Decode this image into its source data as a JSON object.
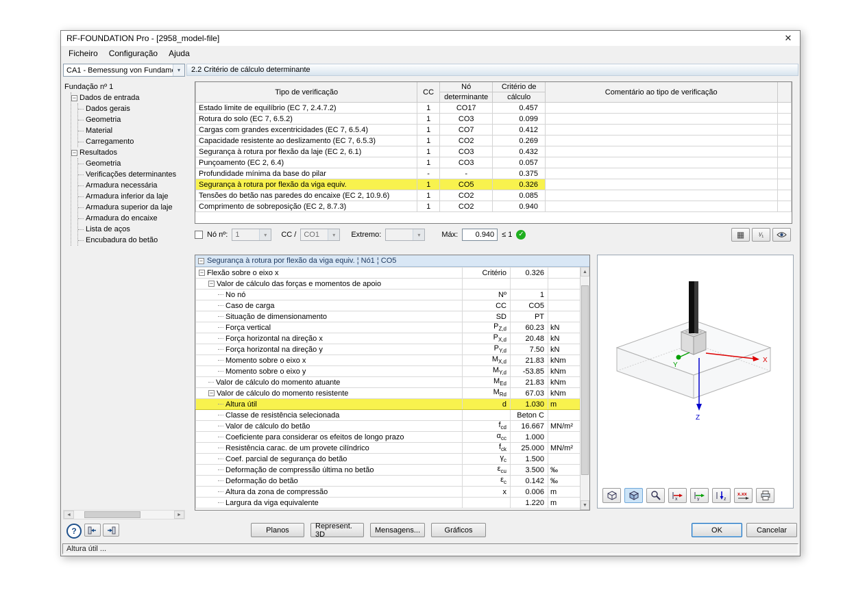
{
  "window": {
    "title": "RF-FOUNDATION Pro - [2958_model-file]"
  },
  "icons": {
    "close": "✕",
    "check": "✓",
    "combo_arrow": "▾",
    "minus": "−",
    "help": "?",
    "scroll_left": "◄",
    "scroll_right": "►",
    "scroll_up": "▲",
    "scroll_down": "▼",
    "grid": "▦",
    "ratio": "¹⁄₁",
    "values_label": "x.xx",
    "axis_x_label": "x",
    "axis_y_label": "y",
    "axis_z_label": "z"
  },
  "colors": {
    "highlight": "#f8f24e",
    "header_blue": "#d9e7f5",
    "green_check": "#1faf1f",
    "pressed_blue": "#cce4f7"
  },
  "menu": [
    "Ficheiro",
    "Configuração",
    "Ajuda"
  ],
  "sidebar": {
    "case_selector": "CA1 - Bemessung von Fundame",
    "tree": {
      "root": "Fundação nº 1",
      "groups": [
        {
          "label": "Dados de entrada",
          "children": [
            "Dados gerais",
            "Geometria",
            "Material",
            "Carregamento"
          ]
        },
        {
          "label": "Resultados",
          "children": [
            "Geometria",
            "Verificações determinantes",
            "Armadura necessária",
            "Armadura inferior da laje",
            "Armadura superior da laje",
            "Armadura do encaixe",
            "Lista de aços",
            "Encubadura do betão"
          ]
        }
      ]
    }
  },
  "section_title": "2.2 Critério de cálculo determinante",
  "summary_table": {
    "headers": {
      "type": "Tipo de verificação",
      "cc": "CC",
      "node1": "Nó",
      "node2": "determinante",
      "crit1": "Critério de",
      "crit2": "cálculo",
      "comment": "Comentário ao tipo de verificação"
    },
    "rows": [
      {
        "type": "Estado limite de equilíbrio (EC 7, 2.4.7.2)",
        "cc": "1",
        "node": "CO17",
        "crit": "0.457",
        "comment": "",
        "highlight": false
      },
      {
        "type": "Rotura do solo (EC 7, 6.5.2)",
        "cc": "1",
        "node": "CO3",
        "crit": "0.099",
        "comment": "",
        "highlight": false
      },
      {
        "type": "Cargas com grandes excentricidades (EC 7, 6.5.4)",
        "cc": "1",
        "node": "CO7",
        "crit": "0.412",
        "comment": "",
        "highlight": false
      },
      {
        "type": "Capacidade resistente ao deslizamento (EC 7, 6.5.3)",
        "cc": "1",
        "node": "CO2",
        "crit": "0.269",
        "comment": "",
        "highlight": false
      },
      {
        "type": "Segurança à rotura por flexão da laje (EC 2, 6.1)",
        "cc": "1",
        "node": "CO3",
        "crit": "0.432",
        "comment": "",
        "highlight": false
      },
      {
        "type": "Punçoamento (EC 2, 6.4)",
        "cc": "1",
        "node": "CO3",
        "crit": "0.057",
        "comment": "",
        "highlight": false
      },
      {
        "type": "Profundidade mínima da base do pilar",
        "cc": "-",
        "node": "-",
        "crit": "0.375",
        "comment": "",
        "highlight": false
      },
      {
        "type": "Segurança à rotura por flexão da viga equiv.",
        "cc": "1",
        "node": "CO5",
        "crit": "0.326",
        "comment": "",
        "highlight": true
      },
      {
        "type": "Tensões do betão nas paredes do encaixe (EC 2, 10.9.6)",
        "cc": "1",
        "node": "CO2",
        "crit": "0.085",
        "comment": "",
        "highlight": false
      },
      {
        "type": "Comprimento de sobreposição (EC 2, 8.7.3)",
        "cc": "1",
        "node": "CO2",
        "crit": "0.940",
        "comment": "",
        "highlight": false
      }
    ]
  },
  "filter": {
    "node_label": "Nó nº:",
    "node_value": "1",
    "cc_label": "CC /",
    "cc_value": "CO1",
    "extremo_label": "Extremo:",
    "extremo_value": "",
    "max_label": "Máx:",
    "max_value": "0.940",
    "max_limit": "≤ 1"
  },
  "detail_panel": {
    "title": "Segurança à rotura por flexão da viga equiv. ¦ Nó1 ¦ CO5",
    "rows": [
      {
        "level": 0,
        "exp": true,
        "label": "Flexão sobre o eixo x",
        "sym": {
          "m": "Critério",
          "s": ""
        },
        "value": "0.326",
        "unit": "",
        "hl": false
      },
      {
        "level": 1,
        "exp": true,
        "label": "Valor de cálculo das forças e momentos de apoio",
        "sym": null,
        "value": "",
        "unit": "",
        "hl": false
      },
      {
        "level": 2,
        "exp": false,
        "label": "No nó",
        "sym": {
          "m": "Nº",
          "s": ""
        },
        "value": "1",
        "unit": "",
        "hl": false
      },
      {
        "level": 2,
        "exp": false,
        "label": "Caso de carga",
        "sym": {
          "m": "CC",
          "s": ""
        },
        "value": "CO5",
        "unit": "",
        "hl": false
      },
      {
        "level": 2,
        "exp": false,
        "label": "Situação de dimensionamento",
        "sym": {
          "m": "SD",
          "s": ""
        },
        "value": "PT",
        "unit": "",
        "hl": false
      },
      {
        "level": 2,
        "exp": false,
        "label": "Força vertical",
        "sym": {
          "m": "P",
          "s": "Z,d"
        },
        "value": "60.23",
        "unit": "kN",
        "hl": false
      },
      {
        "level": 2,
        "exp": false,
        "label": "Força horizontal na direção x",
        "sym": {
          "m": "P",
          "s": "X,d"
        },
        "value": "20.48",
        "unit": "kN",
        "hl": false
      },
      {
        "level": 2,
        "exp": false,
        "label": "Força horizontal na direção y",
        "sym": {
          "m": "P",
          "s": "Y,d"
        },
        "value": "7.50",
        "unit": "kN",
        "hl": false
      },
      {
        "level": 2,
        "exp": false,
        "label": "Momento sobre o eixo x",
        "sym": {
          "m": "M",
          "s": "X,d"
        },
        "value": "21.83",
        "unit": "kNm",
        "hl": false
      },
      {
        "level": 2,
        "exp": false,
        "label": "Momento sobre o eixo y",
        "sym": {
          "m": "M",
          "s": "Y,d"
        },
        "value": "-53.85",
        "unit": "kNm",
        "hl": false
      },
      {
        "level": 1,
        "exp": false,
        "label": "Valor de cálculo do momento atuante",
        "sym": {
          "m": "M",
          "s": "Ed"
        },
        "value": "21.83",
        "unit": "kNm",
        "hl": false
      },
      {
        "level": 1,
        "exp": true,
        "label": "Valor de cálculo do momento resistente",
        "sym": {
          "m": "M",
          "s": "Rd"
        },
        "value": "67.03",
        "unit": "kNm",
        "hl": false
      },
      {
        "level": 2,
        "exp": false,
        "label": "Altura útil",
        "sym": {
          "m": "d",
          "s": ""
        },
        "value": "1.030",
        "unit": "m",
        "hl": true
      },
      {
        "level": 2,
        "exp": false,
        "label": "Classe de resistência selecionada",
        "sym": null,
        "value": "Beton C",
        "unit": "",
        "hl": false
      },
      {
        "level": 2,
        "exp": false,
        "label": "Valor de cálculo do betão",
        "sym": {
          "m": "f",
          "s": "cd"
        },
        "value": "16.667",
        "unit": "MN/m²",
        "hl": false
      },
      {
        "level": 2,
        "exp": false,
        "label": "Coeficiente para considerar os efeitos de longo prazo",
        "sym": {
          "m": "α",
          "s": "cc"
        },
        "value": "1.000",
        "unit": "",
        "hl": false
      },
      {
        "level": 2,
        "exp": false,
        "label": "Resistência carac. de um provete cilíndrico",
        "sym": {
          "m": "f",
          "s": "ck"
        },
        "value": "25.000",
        "unit": "MN/m²",
        "hl": false
      },
      {
        "level": 2,
        "exp": false,
        "label": "Coef. parcial de segurança do betão",
        "sym": {
          "m": "γ",
          "s": "c"
        },
        "value": "1.500",
        "unit": "",
        "hl": false
      },
      {
        "level": 2,
        "exp": false,
        "label": "Deformação de compressão última no betão",
        "sym": {
          "m": "ε",
          "s": "cu"
        },
        "value": "3.500",
        "unit": "‰",
        "hl": false
      },
      {
        "level": 2,
        "exp": false,
        "label": "Deformação do betão",
        "sym": {
          "m": "ε",
          "s": "c"
        },
        "value": "0.142",
        "unit": "‰",
        "hl": false
      },
      {
        "level": 2,
        "exp": false,
        "label": "Altura da zona de compressão",
        "sym": {
          "m": "x",
          "s": ""
        },
        "value": "0.006",
        "unit": "m",
        "hl": false
      },
      {
        "level": 2,
        "exp": false,
        "label": "Largura da viga equivalente",
        "sym": null,
        "value": "1.220",
        "unit": "m",
        "hl": false
      }
    ]
  },
  "viewer": {
    "axis_x": "X",
    "axis_y": "Y",
    "axis_z": "Z"
  },
  "footer": {
    "planos": "Planos",
    "represent": "Represent. 3D",
    "mensagens": "Mensagens...",
    "graficos": "Gráficos",
    "ok": "OK",
    "cancel": "Cancelar"
  },
  "status_bar": "Altura útil ..."
}
